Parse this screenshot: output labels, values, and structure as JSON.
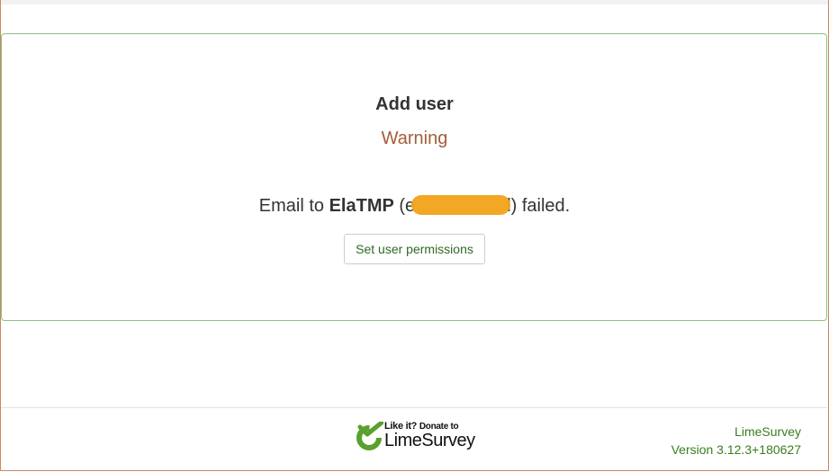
{
  "panel": {
    "title": "Add user",
    "subtitle": "Warning",
    "message_prefix": "Email to ",
    "username": "ElaTMP",
    "email_open": " (e",
    "email_close": "l) failed.",
    "button_label": "Set user permissions"
  },
  "footer": {
    "donate_line1": "Like it?",
    "donate_line2": "Donate to",
    "donate_brand": "LimeSurvey",
    "app_name": "LimeSurvey",
    "version": "Version 3.12.3+180627"
  },
  "colors": {
    "warning": "#a35e3c",
    "accent_green": "#3a7d1e",
    "panel_border": "#8fbf7f",
    "redaction": "#f2a41e"
  }
}
